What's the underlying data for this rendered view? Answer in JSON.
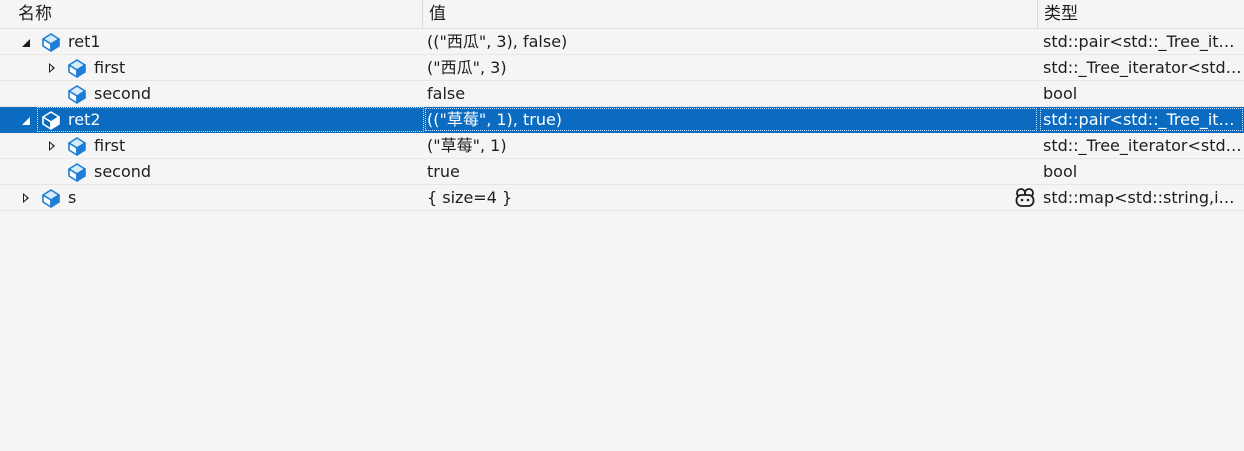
{
  "columns": {
    "name": "名称",
    "value": "值",
    "type": "类型"
  },
  "rows": [
    {
      "name": "ret1",
      "value": "((\"西瓜\", 3), false)",
      "type": "std::pair<std::_Tree_itera...",
      "expanded": true,
      "depth": 0,
      "selected": false
    },
    {
      "name": "first",
      "value": "(\"西瓜\", 3)",
      "type": "std::_Tree_iterator<std::_...",
      "expanded": false,
      "depth": 1,
      "selected": false
    },
    {
      "name": "second",
      "value": "false",
      "type": "bool",
      "expanded": null,
      "depth": 1,
      "selected": false
    },
    {
      "name": "ret2",
      "value": "((\"草莓\", 1), true)",
      "type": "std::pair<std::_Tree_itera...",
      "expanded": true,
      "depth": 0,
      "selected": true
    },
    {
      "name": "first",
      "value": "(\"草莓\", 1)",
      "type": "std::_Tree_iterator<std::_...",
      "expanded": false,
      "depth": 1,
      "selected": false
    },
    {
      "name": "second",
      "value": "true",
      "type": "bool",
      "expanded": null,
      "depth": 1,
      "selected": false
    },
    {
      "name": "s",
      "value": "{ size=4 }",
      "type": "std::map<std::string,int,...",
      "expanded": false,
      "depth": 0,
      "selected": false,
      "visualizer_icon": "visualizer-icon"
    }
  ],
  "colors": {
    "selection": "#0a6bc1",
    "icon_blue": "#1c7ed6"
  }
}
